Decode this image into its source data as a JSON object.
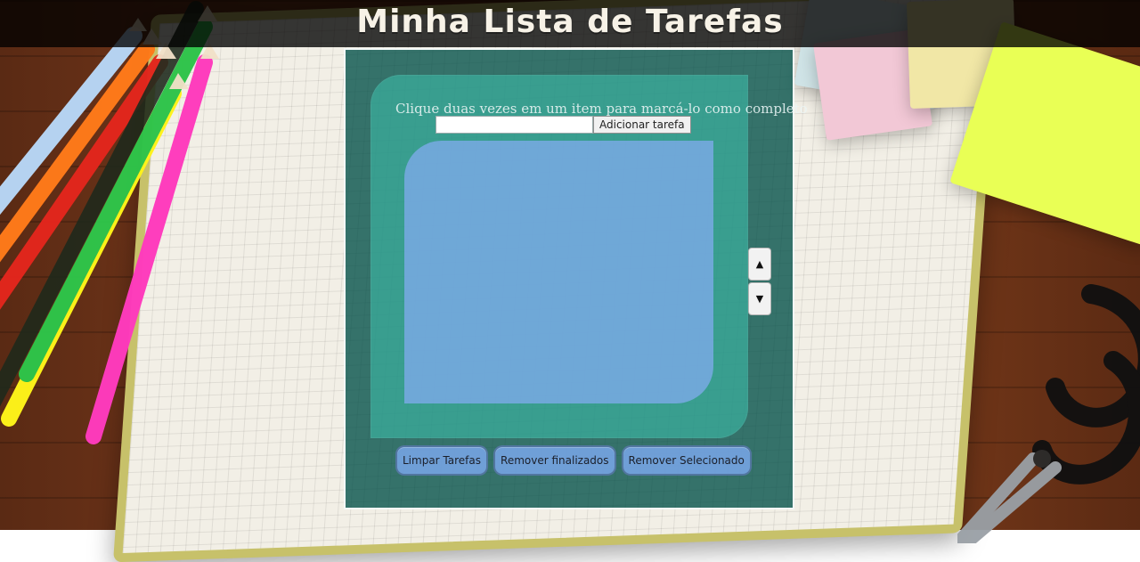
{
  "header": {
    "title": "Minha Lista de Tarefas"
  },
  "panel": {
    "instruction": "Clique duas vezes em um item para marcá-lo como completo",
    "task_input": {
      "value": "",
      "placeholder": ""
    },
    "add_button_label": "Adicionar tarefa",
    "scroll": {
      "up_symbol": "▲",
      "down_symbol": "▼"
    },
    "actions": [
      {
        "label": "Limpar Tarefas"
      },
      {
        "label": "Remover finalizados"
      },
      {
        "label": "Remover Selecionado"
      }
    ]
  }
}
